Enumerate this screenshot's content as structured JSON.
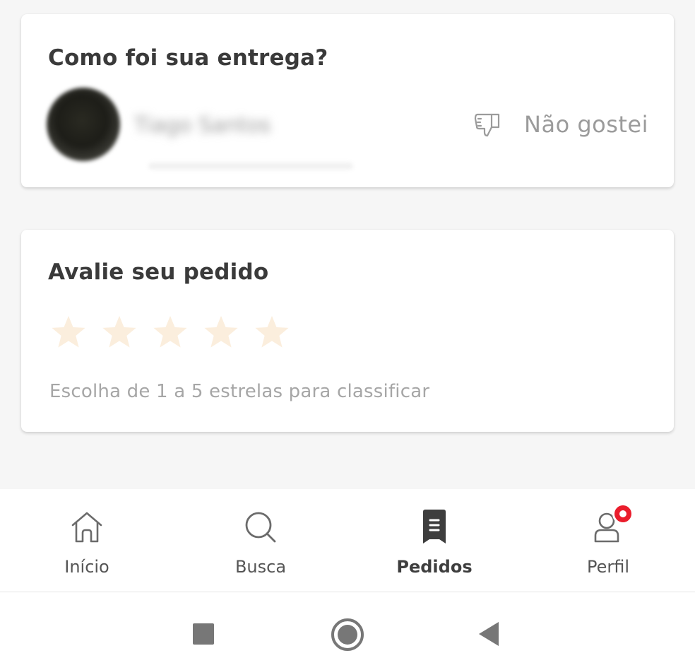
{
  "delivery_card": {
    "title": "Como foi sua entrega?",
    "courier_name": "Tiago Santos",
    "dislike_label": "Não gostei",
    "dislike_icon": "thumbs-down-icon"
  },
  "rating_card": {
    "title": "Avalie seu pedido",
    "star_count": 5,
    "selected_stars": 0,
    "star_color": "#fbeedd",
    "hint": "Escolha de 1 a 5 estrelas para classificar"
  },
  "bottom_nav": {
    "items": [
      {
        "label": "Início",
        "icon": "home-icon",
        "active": false
      },
      {
        "label": "Busca",
        "icon": "search-icon",
        "active": false
      },
      {
        "label": "Pedidos",
        "icon": "orders-icon",
        "active": true
      },
      {
        "label": "Perfil",
        "icon": "profile-icon",
        "active": false,
        "has_notification": true
      }
    ]
  },
  "colors": {
    "accent_red": "#ea1d2c",
    "text_dark": "#3a3a3a",
    "text_muted": "#9b9b9b"
  }
}
